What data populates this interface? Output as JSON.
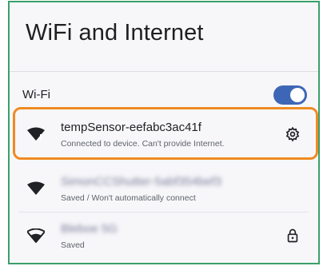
{
  "header": {
    "title": "WiFi and Internet"
  },
  "wifi": {
    "label": "Wi-Fi",
    "enabled": true
  },
  "networks": [
    {
      "name": "tempSensor-eefabc3ac41f",
      "status": "Connected to device. Can't provide Internet.",
      "name_blurred": false,
      "trailing_icon": "gear-icon",
      "highlighted": true
    },
    {
      "name": "SimonCCShutter-5abf354bef3",
      "status": "Saved / Won't automatically connect",
      "name_blurred": true,
      "trailing_icon": "",
      "highlighted": false
    },
    {
      "name": "Bleboe 5G",
      "status": "Saved",
      "name_blurred": true,
      "trailing_icon": "lock-icon",
      "highlighted": false
    }
  ],
  "colors": {
    "accent": "#3d67b6",
    "highlight": "#ef8b22",
    "frame_border": "#3aa06a"
  }
}
